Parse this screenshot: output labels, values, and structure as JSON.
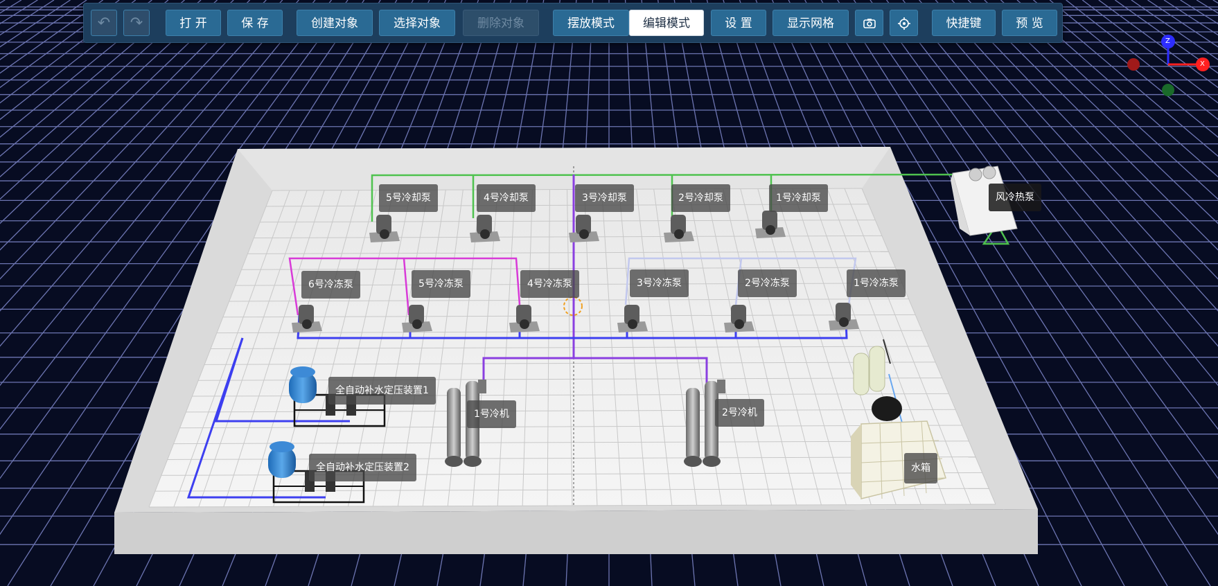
{
  "toolbar": {
    "undo_icon": "undo-icon",
    "redo_icon": "redo-icon",
    "open": "打 开",
    "save": "保 存",
    "create_object": "创建对象",
    "select_object": "选择对象",
    "delete_object": "删除对象",
    "place_mode": "摆放模式",
    "edit_mode": "编辑模式",
    "settings": "设 置",
    "show_grid": "显示网格",
    "screenshot_icon": "camera-icon",
    "locate_icon": "crosshair-icon",
    "shortcuts": "快捷键",
    "preview": "预 览",
    "active_mode": "编辑模式"
  },
  "axes": {
    "x": "X",
    "z": "Z"
  },
  "labels": {
    "cooling_pump_5": "5号冷却泵",
    "cooling_pump_4": "4号冷却泵",
    "cooling_pump_3": "3号冷却泵",
    "cooling_pump_2": "2号冷却泵",
    "cooling_pump_1": "1号冷却泵",
    "chill_pump_6": "6号冷冻泵",
    "chill_pump_5": "5号冷冻泵",
    "chill_pump_4": "4号冷冻泵",
    "chill_pump_3": "3号冷冻泵",
    "chill_pump_2": "2号冷冻泵",
    "chill_pump_1": "1号冷冻泵",
    "heat_pump": "风冷热泵",
    "makeup_unit_1": "全自动补水定压装置1",
    "makeup_unit_2": "全自动补水定压装置2",
    "chiller_1": "1号冷机",
    "chiller_2": "2号冷机",
    "water_tank": "水箱"
  },
  "colors": {
    "background": "#070c22",
    "grid_line": "#8a92d6",
    "toolbar_bg": "#1d3e5d",
    "button_bg": "#2a6a94",
    "pipe_green": "#4fc24f",
    "pipe_purple": "#8a3fe0",
    "pipe_magenta": "#d83ad8",
    "pipe_blue": "#3d3ff0",
    "pipe_lightblue": "#b8c4f0",
    "axis_x": "#ff2020",
    "axis_y": "#2fa03a",
    "axis_z": "#2d2dff"
  }
}
